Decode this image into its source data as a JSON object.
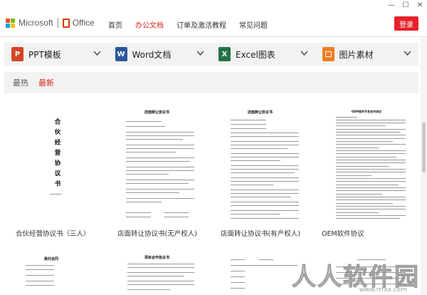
{
  "header": {
    "ms_text": "Microsoft",
    "office_text": "Office",
    "nav": [
      {
        "label": "首页",
        "active": false
      },
      {
        "label": "办公文档",
        "active": true
      },
      {
        "label": "订单及激活教程",
        "active": false
      },
      {
        "label": "常见问题",
        "active": false
      }
    ],
    "login_label": "登录"
  },
  "window_controls": [
    "—",
    "☐",
    "✕"
  ],
  "categories": [
    {
      "label": "PPT模板",
      "icon": "ppt-icon",
      "letter": "P",
      "color": "#d24726"
    },
    {
      "label": "Word文档",
      "icon": "word-icon",
      "letter": "W",
      "color": "#2b579a"
    },
    {
      "label": "Excel图表",
      "icon": "excel-icon",
      "letter": "X",
      "color": "#217346"
    },
    {
      "label": "图片素材",
      "icon": "image-icon",
      "letter": "",
      "color": "#ee7d22"
    }
  ],
  "tabs": [
    {
      "label": "最热",
      "active": false
    },
    {
      "label": "最新",
      "active": true
    }
  ],
  "documents": [
    {
      "caption": "合伙经营协议书（三人）",
      "doc_title": "合伙经营协议书"
    },
    {
      "caption": "店面转让协议书(无产权人)",
      "doc_title": "店面转让协议书"
    },
    {
      "caption": "店面转让协议书(有产权人)",
      "doc_title": "店面转让协议书"
    },
    {
      "caption": "OEM软件协议",
      "doc_title": "OEM软件开发合作协议"
    }
  ],
  "documents_row2": [
    {
      "doc_title": "委托合同"
    },
    {
      "doc_title": "项目合作协议书"
    },
    {
      "doc_title": ""
    },
    {
      "doc_title": ""
    }
  ],
  "watermark": {
    "text": "人人软件园",
    "url": "www.rrfxx.com"
  }
}
